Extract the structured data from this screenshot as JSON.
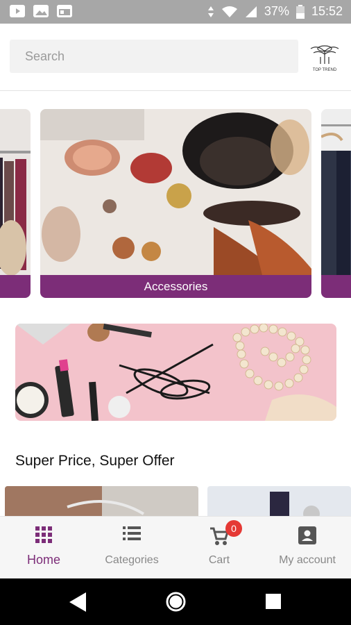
{
  "status_bar": {
    "battery": "37%",
    "time": "15:52"
  },
  "header": {
    "search_placeholder": "Search",
    "logo_text": "TOP TREND"
  },
  "carousel": {
    "items": [
      {
        "label": ""
      },
      {
        "label": "Accessories"
      },
      {
        "label": ""
      }
    ]
  },
  "section": {
    "title": "Super Price, Super Offer"
  },
  "bottom_nav": {
    "items": [
      {
        "label": "Home",
        "icon": "grid-icon",
        "active": true
      },
      {
        "label": "Categories",
        "icon": "list-icon",
        "active": false
      },
      {
        "label": "Cart",
        "icon": "cart-icon",
        "active": false,
        "badge": "0"
      },
      {
        "label": "My account",
        "icon": "account-icon",
        "active": false
      }
    ]
  },
  "colors": {
    "accent": "#7c2d78",
    "badge": "#e53935",
    "status_bar": "#a7a7a7"
  }
}
